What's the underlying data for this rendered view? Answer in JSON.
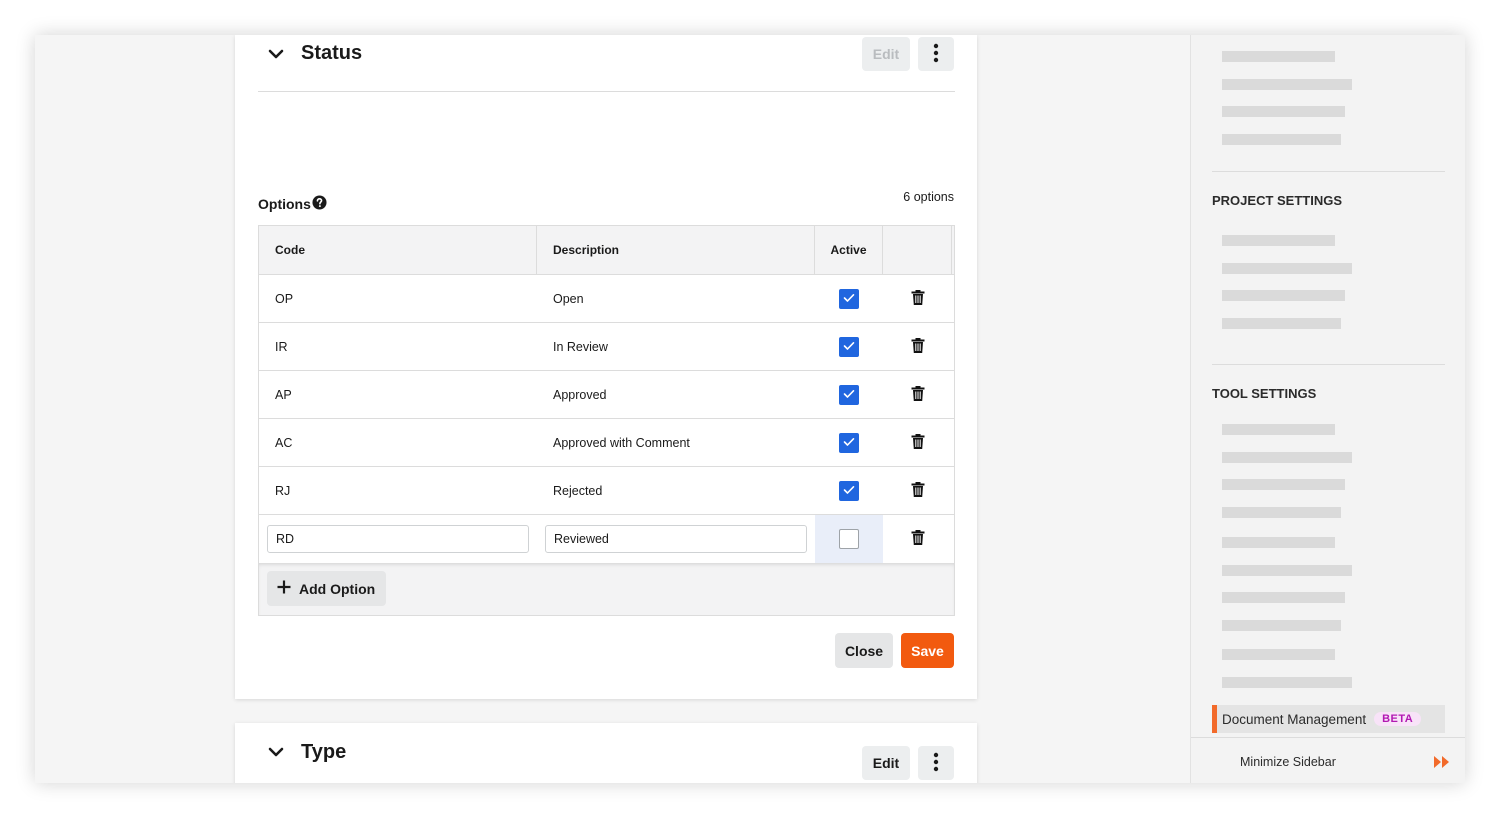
{
  "status_section": {
    "title": "Status",
    "edit_label": "Edit",
    "options_label": "Options",
    "options_count": "6 options",
    "columns": {
      "code": "Code",
      "description": "Description",
      "active": "Active"
    },
    "rows": [
      {
        "code": "OP",
        "description": "Open",
        "active": true
      },
      {
        "code": "IR",
        "description": "In Review",
        "active": true
      },
      {
        "code": "AP",
        "description": "Approved",
        "active": true
      },
      {
        "code": "AC",
        "description": "Approved with Comment",
        "active": true
      },
      {
        "code": "RJ",
        "description": "Rejected",
        "active": true
      }
    ],
    "editing_row": {
      "code": "RD",
      "description": "Reviewed",
      "active": false
    },
    "add_option_label": "Add Option",
    "close_label": "Close",
    "save_label": "Save"
  },
  "type_section": {
    "title": "Type",
    "edit_label": "Edit"
  },
  "sidebar": {
    "project_settings_heading": "PROJECT SETTINGS",
    "tool_settings_heading": "TOOL SETTINGS",
    "active_item": {
      "label": "Document Management",
      "badge": "BETA"
    },
    "minimize_label": "Minimize Sidebar"
  },
  "colors": {
    "accent_orange": "#f25a0f",
    "checkbox_blue": "#2066df",
    "beta_text": "#b219b2",
    "beta_bg": "#f8e3f8"
  },
  "icons": [
    "chevron-down-icon",
    "kebab-menu-icon",
    "help-circle-icon",
    "trash-icon",
    "checkmark-icon",
    "plus-icon",
    "double-chevron-right-icon"
  ]
}
